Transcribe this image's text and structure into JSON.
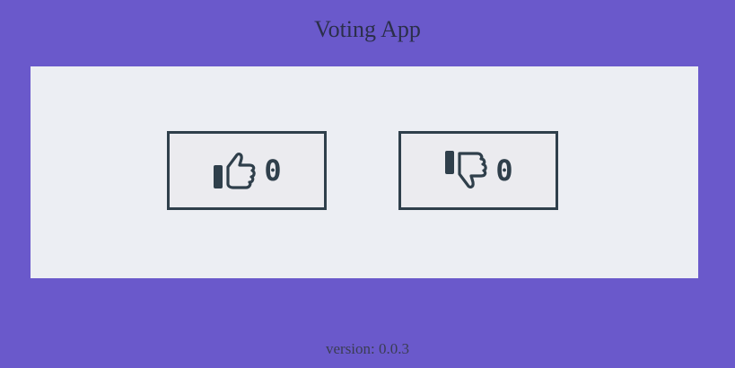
{
  "app": {
    "title": "Voting App",
    "version_label": "version: 0.0.3"
  },
  "votes": {
    "up": {
      "icon": "thumbs-up-icon",
      "count": "0"
    },
    "down": {
      "icon": "thumbs-down-icon",
      "count": "0"
    }
  },
  "colors": {
    "background": "#6a59cb",
    "panel": "#eceef3",
    "button_border": "#2f3f4b"
  }
}
